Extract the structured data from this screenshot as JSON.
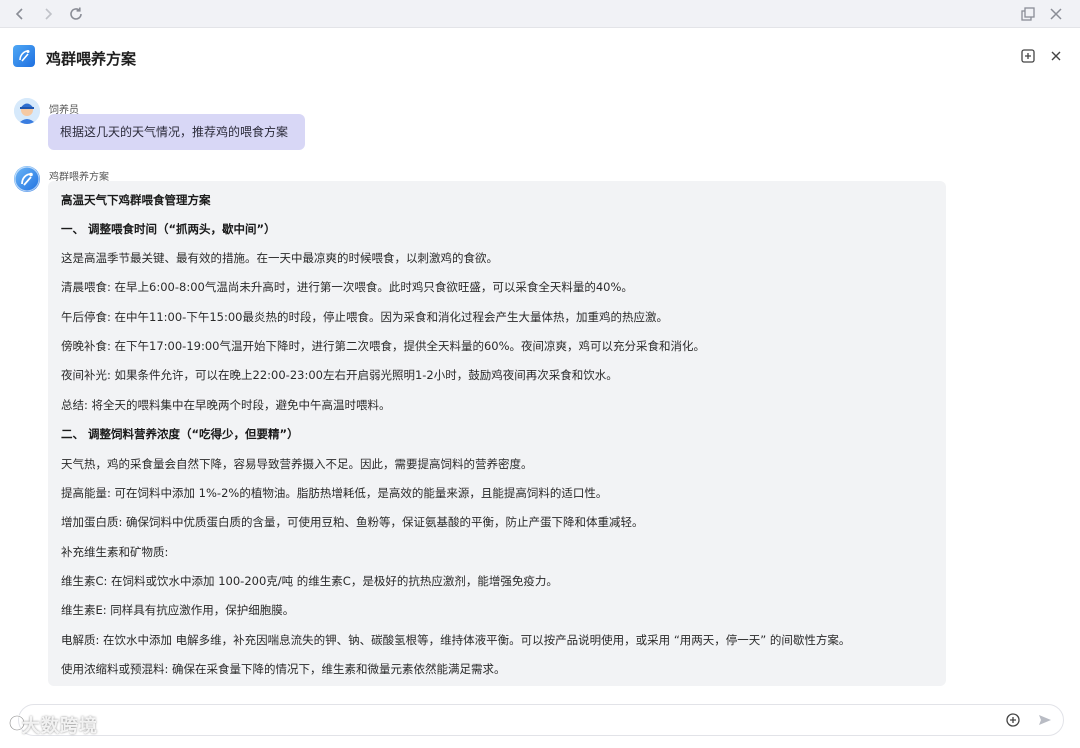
{
  "app": {
    "title": "鸡群喂养方案"
  },
  "colors": {
    "user_bubble": "#d8d7f6",
    "bot_card": "#f2f3f5",
    "accent": "#1e6fe0"
  },
  "messages": {
    "user": {
      "sender": "饲养员",
      "text": "根据这几天的天气情况，推荐鸡的喂食方案"
    },
    "bot": {
      "sender": "鸡群喂养方案",
      "lines": [
        "高温天气下鸡群喂食管理方案",
        "一、 调整喂食时间（“抓两头，歇中间”）",
        "这是高温季节最关键、最有效的措施。在一天中最凉爽的时候喂食，以刺激鸡的食欲。",
        "清晨喂食:   在早上6:00-8:00气温尚未升高时，进行第一次喂食。此时鸡只食欲旺盛，可以采食全天料量的40%。",
        "午后停食:   在中午11:00-下午15:00最炎热的时段，停止喂食。因为采食和消化过程会产生大量体热，加重鸡的热应激。",
        "傍晚补食:   在下午17:00-19:00气温开始下降时，进行第二次喂食，提供全天料量的60%。夜间凉爽，鸡可以充分采食和消化。",
        "夜间补光:   如果条件允许，可以在晚上22:00-23:00左右开启弱光照明1-2小时，鼓励鸡夜间再次采食和饮水。",
        "总结:   将全天的喂料集中在早晚两个时段，避免中午高温时喂料。",
        "二、 调整饲料营养浓度（“吃得少，但要精”）",
        "天气热，鸡的采食量会自然下降，容易导致营养摄入不足。因此，需要提高饲料的营养密度。",
        "提高能量:   可在饲料中添加 1%-2%的植物油。脂肪热增耗低，是高效的能量来源，且能提高饲料的适口性。",
        "增加蛋白质:   确保饲料中优质蛋白质的含量，可使用豆粕、鱼粉等，保证氨基酸的平衡，防止产蛋下降和体重减轻。",
        "补充维生素和矿物质:",
        "维生素C:   在饲料或饮水中添加 100-200克/吨 的维生素C，是极好的抗热应激剂，能增强免疫力。",
        "维生素E:   同样具有抗应激作用，保护细胞膜。",
        "电解质:   在饮水中添加 电解多维，补充因喘息流失的钾、钠、碳酸氢根等，维持体液平衡。可以按产品说明使用，或采用 “用两天，停一天” 的间歇性方案。",
        "使用浓缩料或预混料:   确保在采食量下降的情况下，维生素和微量元素依然能满足需求。"
      ]
    }
  },
  "input": {
    "placeholder": ""
  },
  "watermark": "大数跨境",
  "icons": {
    "back": "chevron-left-icon",
    "forward": "chevron-right-icon",
    "reload": "reload-icon",
    "popout": "popout-icon",
    "close": "close-icon",
    "new_chat": "plus-square-icon",
    "attach": "plus-circle-icon",
    "send": "send-icon"
  }
}
